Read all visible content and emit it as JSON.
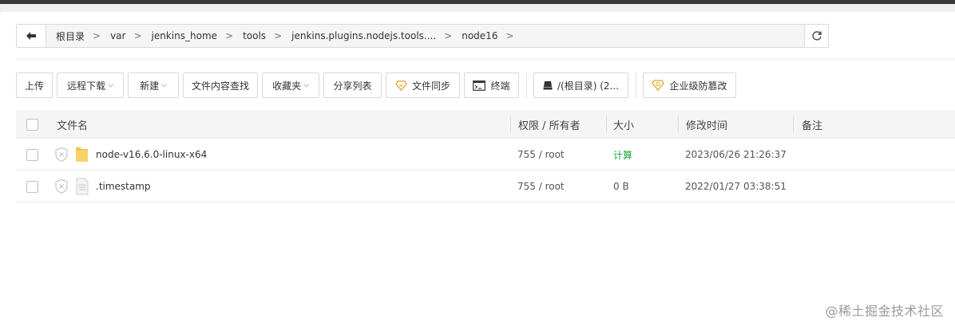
{
  "breadcrumb": {
    "items": [
      "根目录",
      "var",
      "jenkins_home",
      "tools",
      "jenkins.plugins.nodejs.tools....",
      "node16"
    ]
  },
  "toolbar": {
    "upload": "上传",
    "remote_download": "远程下载",
    "new": "新建",
    "content_search": "文件内容查找",
    "favorites": "收藏夹",
    "share_list": "分享列表",
    "file_sync": "文件同步",
    "terminal": "终端",
    "disk": "/(根目录) (2...",
    "tamper_proof": "企业级防篡改"
  },
  "table": {
    "headers": {
      "name": "文件名",
      "permission": "权限 / 所有者",
      "size": "大小",
      "mtime": "修改时间",
      "note": "备注"
    },
    "rows": [
      {
        "name": "node-v16.6.0-linux-x64",
        "type": "folder",
        "permission": "755 / root",
        "size": "计算",
        "mtime": "2023/06/26 21:26:37",
        "note": ""
      },
      {
        "name": ".timestamp",
        "type": "file",
        "permission": "755 / root",
        "size": "0 B",
        "mtime": "2022/01/27 03:38:51",
        "note": ""
      }
    ]
  },
  "watermark": "@稀土掘金技术社区",
  "colors": {
    "accent_green": "#20a53a",
    "gold_icon": "#e0a52a",
    "folder": "#f6c64b"
  }
}
